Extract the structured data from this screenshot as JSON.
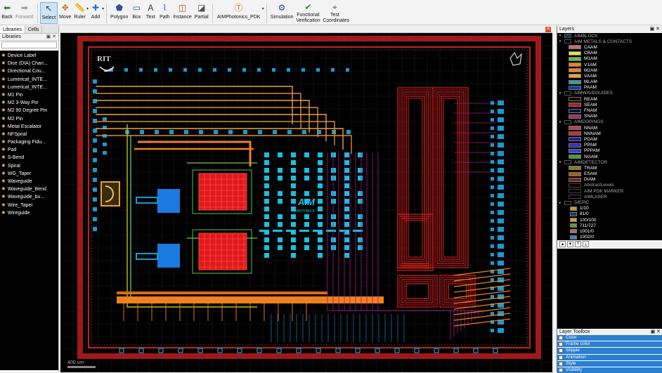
{
  "toolbar": {
    "items": [
      {
        "label": "Back",
        "icon": "back-arrow-icon"
      },
      {
        "label": "Forward",
        "icon": "forward-arrow-icon"
      },
      {
        "label": "Select",
        "icon": "cursor-icon"
      },
      {
        "label": "Move",
        "icon": "move-icon"
      },
      {
        "label": "Ruler",
        "icon": "ruler-icon"
      },
      {
        "label": "Add",
        "icon": "add-icon"
      },
      {
        "label": "Polygon",
        "icon": "polygon-icon"
      },
      {
        "label": "Box",
        "icon": "box-icon"
      },
      {
        "label": "Text",
        "icon": "text-icon"
      },
      {
        "label": "Path",
        "icon": "path-icon"
      },
      {
        "label": "Instance",
        "icon": "instance-icon"
      },
      {
        "label": "Partial",
        "icon": "partial-icon"
      },
      {
        "label": "AIMPhotonics_PDK",
        "icon": "pdk-icon"
      },
      {
        "label": "Simulation",
        "icon": "simulation-icon"
      },
      {
        "label": "Functional Verification",
        "icon": "verification-icon"
      },
      {
        "label": "Test Coordinates",
        "icon": "coordinates-icon"
      }
    ]
  },
  "left_panel": {
    "tabs": [
      "Libraries",
      "Cells"
    ],
    "header": "Libraries",
    "items": [
      "Device Label",
      "Dice (DIA) Chan...",
      "Directional Cou...",
      "Lumerical_INTE...",
      "Lumerical_INTE...",
      "M1 Pin",
      "M2 3-Way Pin",
      "M2 90 Degree Pin",
      "M2 Pin",
      "Metal Escalator",
      "NFSpiral",
      "Packaging Fidu...",
      "Pad",
      "S-Bend",
      "Spiral",
      "WG_Taper",
      "Waveguide",
      "Waveguide_Bend",
      "Waveguide_bu...",
      "Wire_Taper",
      "Wireguide"
    ]
  },
  "canvas": {
    "logo_text": "AIM",
    "logo_sub": "PHOTONICS",
    "rit_text": "RIT",
    "scale_label": "400 um"
  },
  "layers": {
    "header": "Layers",
    "rows": [
      {
        "label": "AIMBLOCK",
        "kind": "grp",
        "color": "#1a2a6a"
      },
      {
        "label": "AIM METALS & CONTACTS",
        "kind": "grp"
      },
      {
        "label": "CAAM",
        "color": "#c07070"
      },
      {
        "label": "CBAM",
        "color": "#e0e060"
      },
      {
        "label": "M1AM",
        "color": "#60c040"
      },
      {
        "label": "V1AM",
        "color": "#f08020"
      },
      {
        "label": "M2AM",
        "color": "#f08020"
      },
      {
        "label": "VAAM",
        "color": "#f0a030"
      },
      {
        "label": "MLAM",
        "color": "#30a0a0"
      },
      {
        "label": "PAAM",
        "color": "#1040a0"
      },
      {
        "label": "AIMWAVEGUIDES",
        "kind": "grp"
      },
      {
        "label": "REAM",
        "color": "#000000"
      },
      {
        "label": "SEAM",
        "color": "#b02020"
      },
      {
        "label": "FNAM",
        "color": "#101040"
      },
      {
        "label": "SNAM",
        "color": "#a03060"
      },
      {
        "label": "AIMDOPINGS",
        "kind": "grp"
      },
      {
        "label": "NNAM",
        "color": "#c04040"
      },
      {
        "label": "NNNAM",
        "color": "#c03030"
      },
      {
        "label": "PDAM",
        "color": "#2020a0"
      },
      {
        "label": "PPAM",
        "color": "#3030c0"
      },
      {
        "label": "PPPAM",
        "color": "#4040e0"
      },
      {
        "label": "NGAM",
        "color": "#40a040"
      },
      {
        "label": "AIMDETECTOR",
        "kind": "grp"
      },
      {
        "label": "TRAM",
        "color": "#808020"
      },
      {
        "label": "ESAM",
        "color": "#a06020"
      },
      {
        "label": "DIAM",
        "color": "#802020"
      },
      {
        "label": "AbstractLevels",
        "kind": "sub"
      },
      {
        "label": "AIM PDK MARKER",
        "kind": "sub"
      },
      {
        "label": "AIMLASER",
        "kind": "sub"
      },
      {
        "label": "SIEPIC",
        "kind": "grp2"
      },
      {
        "label": "1/10",
        "color": "#c0a020",
        "small": true
      },
      {
        "label": "81/0",
        "color": "#203080",
        "small": true
      },
      {
        "label": "100/100",
        "color": "#d0a020",
        "small": true
      },
      {
        "label": "711/727",
        "color": "#60a020",
        "small": true
      },
      {
        "label": "1001/0",
        "color": "#c06080",
        "small": true
      },
      {
        "label": "1002/0",
        "color": "#4080c0",
        "small": true
      }
    ],
    "toolbox_header": "Layer Toolbox",
    "toolbox": [
      "Color",
      "Frame color",
      "Stipple",
      "Animation",
      "Style",
      "Visibility"
    ]
  }
}
